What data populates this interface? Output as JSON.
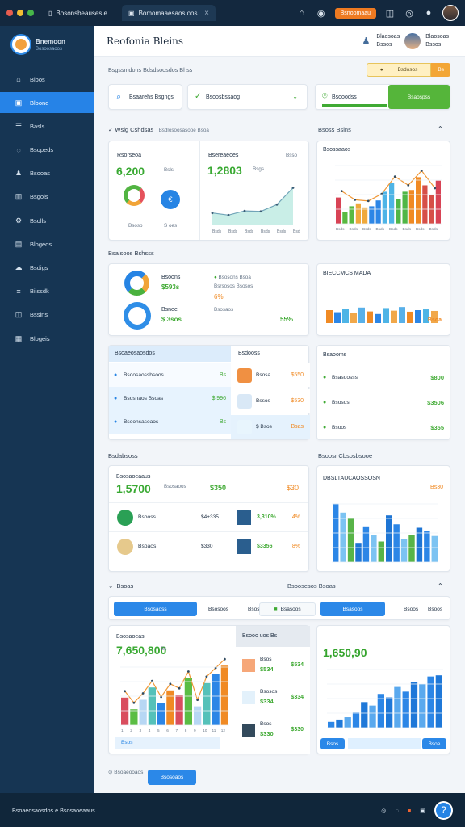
{
  "window": {
    "tab_title": "Bosonsbeauses e",
    "active_tab": "Bomomaaesaos oos",
    "upgrade": "Bsnoomaau"
  },
  "sidebar": {
    "brand_title": "Bnemoon",
    "brand_subtitle": "Bosoosaoos",
    "items": [
      {
        "label": "Bloos",
        "icon": "home-icon"
      },
      {
        "label": "Bloone",
        "icon": "grid-icon"
      },
      {
        "label": "Basls",
        "icon": "table-icon"
      },
      {
        "label": "Bsopeds",
        "icon": "chat-icon"
      },
      {
        "label": "Bsooas",
        "icon": "users-icon"
      },
      {
        "label": "Bsgols",
        "icon": "chart-icon"
      },
      {
        "label": "Bsolls",
        "icon": "settings-icon"
      },
      {
        "label": "Blogeos",
        "icon": "document-icon"
      },
      {
        "label": "Bsdigs",
        "icon": "cloud-icon"
      },
      {
        "label": "Bilssdk",
        "icon": "list-icon"
      },
      {
        "label": "Bsslns",
        "icon": "message-icon"
      },
      {
        "label": "Blogeis",
        "icon": "lock-icon"
      }
    ]
  },
  "header": {
    "title": "Reofonia Bleins",
    "user_name": "Blaosoas",
    "user_role": "Bssos"
  },
  "toolbar": {
    "breadcrumb": "Bsgssmdons Bdsdsoosdos Bhss",
    "warning_label": "Bsdosos",
    "warning_count": "Bs",
    "search_label": "Bsaarehs Bsgngs",
    "select_value": "Bsoosbssaog",
    "filter_label": "Bsooodss",
    "apply_label": "Bsaospss"
  },
  "section1": {
    "title": "Wslg Cshdsas",
    "subtitle": "Bsdlosoosasooe Bsoa",
    "metric_a_label": "Rsorseoa",
    "metric_a_value": "6,200",
    "metric_a_sub": "Bsls",
    "metric_a_foot1": "Bsosb",
    "metric_a_foot2": "S oes",
    "metric_b_label": "Bsereaeoes",
    "metric_b_value": "1,2803",
    "metric_b_sub": "Bsgs",
    "metric_b_note": "Bsso",
    "right_title": "Bsoss Bslns",
    "right_label": "Bsossaaos"
  },
  "section2": {
    "title": "Bsalsoos Bshsss",
    "row1_label": "Bsoons",
    "row1_value": "$593s",
    "row1_small": "Bsosons Bsoa",
    "row1_detail": "Bsrsosos Bsosos",
    "row1_percent": "6%",
    "row2_label": "Bsnee",
    "row2_value": "$ 3sos",
    "row2_note": "Bsosaos",
    "row2_percent": "55%",
    "right_title": "BIECCMCS MADA",
    "right_value": "Bsoa"
  },
  "section3": {
    "tabs_title": "Bsoaeosaosdos",
    "tab_b": "Bsdooss",
    "list": [
      {
        "label": "Bsoosaossbsoos",
        "value": "Bs"
      },
      {
        "label": "Bsosnaos Bsoas",
        "value": "$ 996"
      },
      {
        "label": "Bsoonsasoaos",
        "value": "Bs"
      }
    ],
    "cards": [
      {
        "label": "Bsosa",
        "value": "$550"
      },
      {
        "label": "Bssos",
        "value": "$530"
      },
      {
        "label": "$ Bsos",
        "value": "Bsas"
      }
    ],
    "right_title": "Bsaooms",
    "right_rows": [
      {
        "label": "Bsasoosss",
        "value": "$800"
      },
      {
        "label": "Bsosos",
        "value": "$3506"
      },
      {
        "label": "Bsoos",
        "value": "$355"
      }
    ]
  },
  "section4": {
    "title": "Bsdabsoss",
    "metric": "1,5700",
    "metric_label": "Bsosaoos",
    "metric_change": "$350",
    "metric_side": "$30",
    "table_title": "Bsosaoeaaus",
    "rows": [
      {
        "name": "Bsooss",
        "value": "$4+335",
        "percent": "4%"
      },
      {
        "name": "Bsoaos",
        "value": "$330",
        "percent": "$3%"
      }
    ],
    "mini_rows": [
      {
        "value": "3,310%",
        "percent": "4%"
      },
      {
        "value": "$3356",
        "percent": "8%"
      }
    ],
    "right_title": "Bsoosr Cbsosbsooe",
    "right_heading": "DBSLTAUCAOSSOSN",
    "right_value": "Bs30"
  },
  "section5": {
    "title": "Bsoas",
    "right_title": "Bsoosesos Bsoas",
    "tab1": "Bsosaoss",
    "tab2": "Bsosoos",
    "tab3": "Bsasoos",
    "tab4": "Bsoos",
    "metric": "7,650,800",
    "metric_note": "Bs",
    "metric_label": "Bsosaoeas",
    "metric_btn": "Bsos",
    "middle_title": "Bsooo uos Bs",
    "middle_rows": [
      {
        "name": "Bsos",
        "value": "$534"
      },
      {
        "name": "Bsosos",
        "value": "$334"
      },
      {
        "name": "Bsos",
        "value": "$330"
      }
    ],
    "right_metric": "1,650,90",
    "right_btn1": "Bsos",
    "right_btn2": "Bsoe"
  },
  "footer": {
    "left": "Bsoaeosaosdos e Bsosaoeaaus",
    "action": "Bsoaeooaos",
    "link": "Bsosoaos"
  },
  "colors": {
    "accent": "#2684e4",
    "sidebar": "#163553",
    "success": "#40aa34",
    "warning": "#f08a24"
  },
  "chart_data": [
    {
      "type": "area",
      "x": [
        "Bsds",
        "Bsds",
        "Bsds",
        "Bsds",
        "Bsds",
        "Bsds"
      ],
      "values": [
        22,
        18,
        26,
        25,
        38,
        70
      ]
    },
    {
      "type": "bar",
      "categories": [
        "Bsds",
        "Bsds",
        "Bsds",
        "Bsds",
        "Bsds",
        "Bsds",
        "Bsds",
        "Bsds"
      ],
      "series": [
        {
          "values": [
            45,
            30,
            28,
            40,
            70,
            55,
            80,
            50
          ]
        },
        {
          "values": [
            20,
            35,
            30,
            55,
            42,
            58,
            66,
            74
          ]
        }
      ]
    },
    {
      "type": "bar",
      "categories": [
        "1",
        "2",
        "3",
        "4",
        "5",
        "6",
        "7",
        "8",
        "9",
        "10",
        "11",
        "12",
        "13",
        "14"
      ],
      "series": [
        {
          "values": [
            50,
            42,
            55,
            38,
            60,
            45,
            35,
            58,
            48,
            62,
            44,
            50,
            53,
            47
          ]
        }
      ]
    },
    {
      "type": "bar",
      "categories": [
        "1",
        "2",
        "3",
        "4",
        "5",
        "6",
        "7",
        "8",
        "9",
        "10",
        "11",
        "12",
        "13",
        "14"
      ],
      "series": [
        {
          "values": [
            85,
            72,
            64,
            28,
            52,
            40,
            30,
            68,
            55,
            34,
            40,
            50,
            45,
            38
          ]
        }
      ]
    },
    {
      "type": "bar",
      "categories": [
        "1",
        "2",
        "3",
        "4",
        "5",
        "6",
        "7",
        "8",
        "9",
        "10",
        "11",
        "12"
      ],
      "series": [
        {
          "values": [
            38,
            22,
            35,
            52,
            30,
            48,
            42,
            65,
            26,
            58,
            70,
            82
          ]
        }
      ]
    },
    {
      "type": "bar",
      "categories": [
        "1",
        "2",
        "3",
        "4",
        "5",
        "6",
        "7",
        "8",
        "9",
        "10",
        "11",
        "12",
        "13",
        "14"
      ],
      "series": [
        {
          "values": [
            10,
            14,
            18,
            26,
            44,
            38,
            58,
            52,
            70,
            62,
            78,
            75,
            88,
            90
          ]
        }
      ]
    }
  ]
}
